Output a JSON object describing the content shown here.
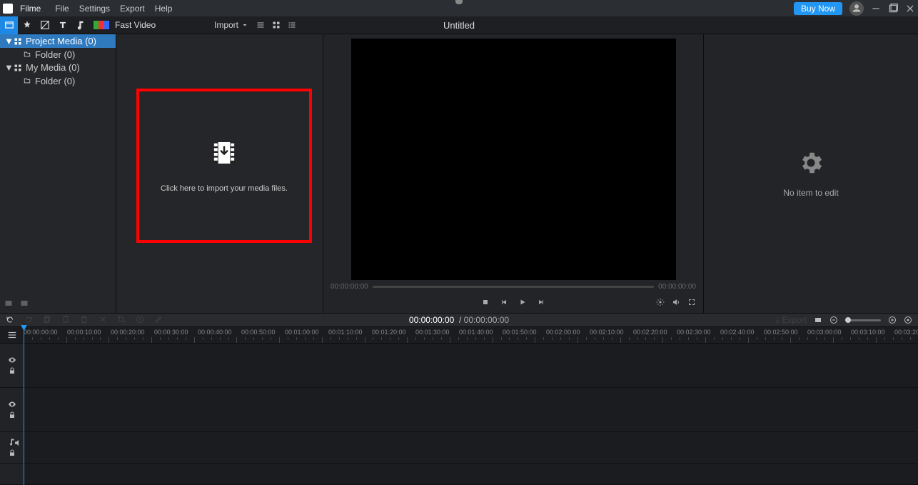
{
  "titlebar": {
    "app_name": "Filme",
    "menu": [
      "File",
      "Settings",
      "Export",
      "Help"
    ],
    "buy": "Buy Now"
  },
  "toolbar": {
    "fast_video": "Fast Video",
    "import": "Import",
    "title": "Untitled"
  },
  "tree": {
    "items": [
      {
        "label": "Project Media (0)",
        "children": [
          {
            "label": "Folder (0)"
          }
        ],
        "selected": true
      },
      {
        "label": "My Media (0)",
        "children": [
          {
            "label": "Folder (0)"
          }
        ],
        "selected": false
      }
    ]
  },
  "import_text": "Click here to import your media files.",
  "preview": {
    "seek_start": "00:00:00:00",
    "seek_end": "00:00:00:00"
  },
  "inspector": {
    "empty": "No item to edit"
  },
  "timeline": {
    "current": "00:00:00:00",
    "duration": "00:00:00:00",
    "export_label": "Export",
    "stamps": [
      "00:00:00:00",
      "00:00:10:00",
      "00:00:20:00",
      "00:00:30:00",
      "00:00:40:00",
      "00:00:50:00",
      "00:01:00:00",
      "00:01:10:00",
      "00:01:20:00",
      "00:01:30:00",
      "00:01:40:00",
      "00:01:50:00",
      "00:02:00:00",
      "00:02:10:00",
      "00:02:20:00",
      "00:02:30:00",
      "00:02:40:00",
      "00:02:50:00",
      "00:03:00:00",
      "00:03:10:00",
      "00:03:20:00"
    ]
  },
  "colors": {
    "accent": "#2196f3",
    "highlight": "#ff0000",
    "sel": "#2f7abf"
  }
}
